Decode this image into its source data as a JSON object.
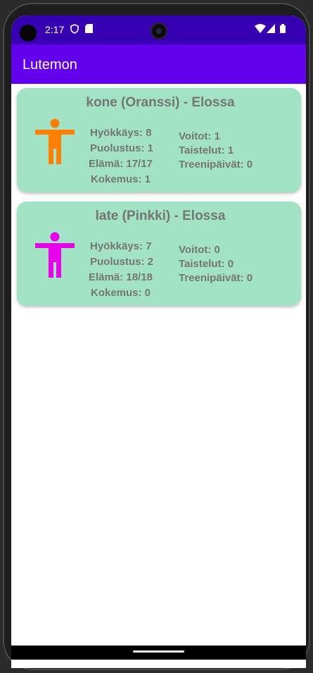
{
  "status_bar": {
    "time": "2:17",
    "icons": [
      "shield-icon",
      "sd-card-icon",
      "wifi-icon",
      "signal-icon",
      "battery-icon"
    ]
  },
  "app_bar": {
    "title": "Lutemon"
  },
  "colors": {
    "status_bar": "#3700b3",
    "app_bar": "#6200ee",
    "card_bg": "#a3e3c5",
    "text_gray": "#757575"
  },
  "lutemons": [
    {
      "title": "kone (Oranssi) - Elossa",
      "color": "#ff7f00",
      "attack": "Hyökkäys: 8",
      "defense": "Puolustus: 1",
      "health": "Elämä: 17/17",
      "experience": "Kokemus: 1",
      "wins": "Voitot: 1",
      "battles": "Taistelut: 1",
      "training_days": "Treenipäivät: 0"
    },
    {
      "title": "late (Pinkki) - Elossa",
      "color": "#ea00ea",
      "attack": "Hyökkäys: 7",
      "defense": "Puolustus: 2",
      "health": "Elämä: 18/18",
      "experience": "Kokemus: 0",
      "wins": "Voitot: 0",
      "battles": "Taistelut: 0",
      "training_days": "Treenipäivät: 0"
    }
  ]
}
